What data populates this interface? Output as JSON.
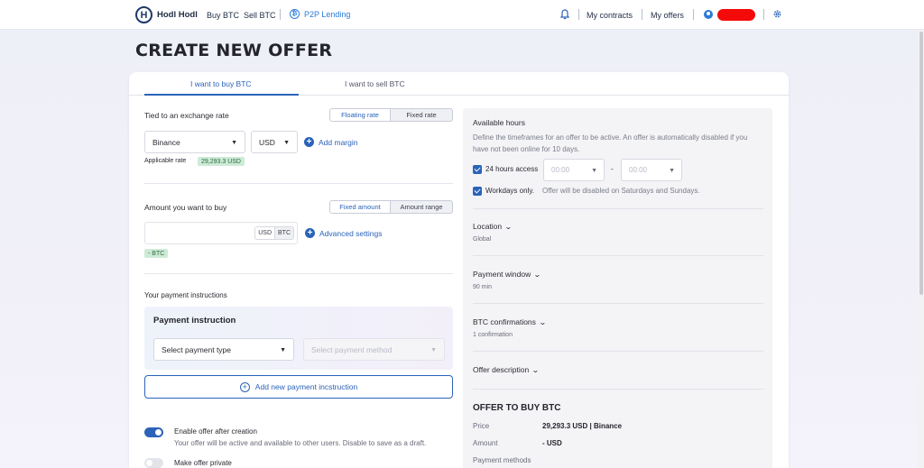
{
  "nav": {
    "logo": "Hodl Hodl",
    "buy_btc": "Buy BTC",
    "sell_btc": "Sell BTC",
    "p2p_lending": "P2P Lending",
    "my_contracts": "My contracts",
    "my_offers": "My offers"
  },
  "page": {
    "title": "CREATE NEW OFFER"
  },
  "tabs": [
    {
      "label": "I want to buy BTC",
      "active": true
    },
    {
      "label": "I want to sell BTC",
      "active": false
    }
  ],
  "rate": {
    "label": "Tied to an exchange rate",
    "modes": [
      "Floating rate",
      "Fixed rate"
    ],
    "exchange": "Binance",
    "currency": "USD",
    "add_margin": "Add margin",
    "applicable_label": "Applicable rate",
    "applicable_value": "29,293.3 USD"
  },
  "amount": {
    "label": "Amount you want to buy",
    "modes": [
      "Fixed amount",
      "Amount range"
    ],
    "unit_options": [
      "USD",
      "BTC"
    ],
    "advanced": "Advanced settings",
    "btc_badge": "- BTC"
  },
  "payment": {
    "section_label": "Your payment instructions",
    "box_title": "Payment instruction",
    "type_placeholder": "Select payment type",
    "method_placeholder": "Select payment method",
    "add_new": "Add new payment incstruction"
  },
  "options": {
    "enable_label": "Enable offer after creation",
    "enable_desc": "Your offer will be active and available to other users. Disable to save as a draft.",
    "enable_on": true,
    "private_label": "Make offer private",
    "private_on": false
  },
  "hours": {
    "title": "Available hours",
    "desc": "Define the timeframes for an offer to be active. An offer is automatically disabled if you have not been online for 10 days.",
    "access_label": "24 hours access",
    "from": "00:00",
    "dash": "-",
    "to": "00:00",
    "workdays_label": "Workdays only.",
    "workdays_desc": "Offer will be disabled on Saturdays and Sundays."
  },
  "sections": [
    {
      "title": "Location",
      "value": "Global"
    },
    {
      "title": "Payment window",
      "value": "90 min"
    },
    {
      "title": "BTC confirmations",
      "value": "1 confirmation"
    },
    {
      "title": "Offer description",
      "value": ""
    }
  ],
  "summary": {
    "title": "OFFER TO BUY BTC",
    "price_label": "Price",
    "price_value": "29,293.3 USD | Binance",
    "amount_label": "Amount",
    "amount_value": "- USD",
    "methods_label": "Payment methods"
  },
  "colors": {
    "accent": "#2a63b8",
    "badge_bg": "#cdebd6",
    "redaction": "#f50a0a"
  }
}
